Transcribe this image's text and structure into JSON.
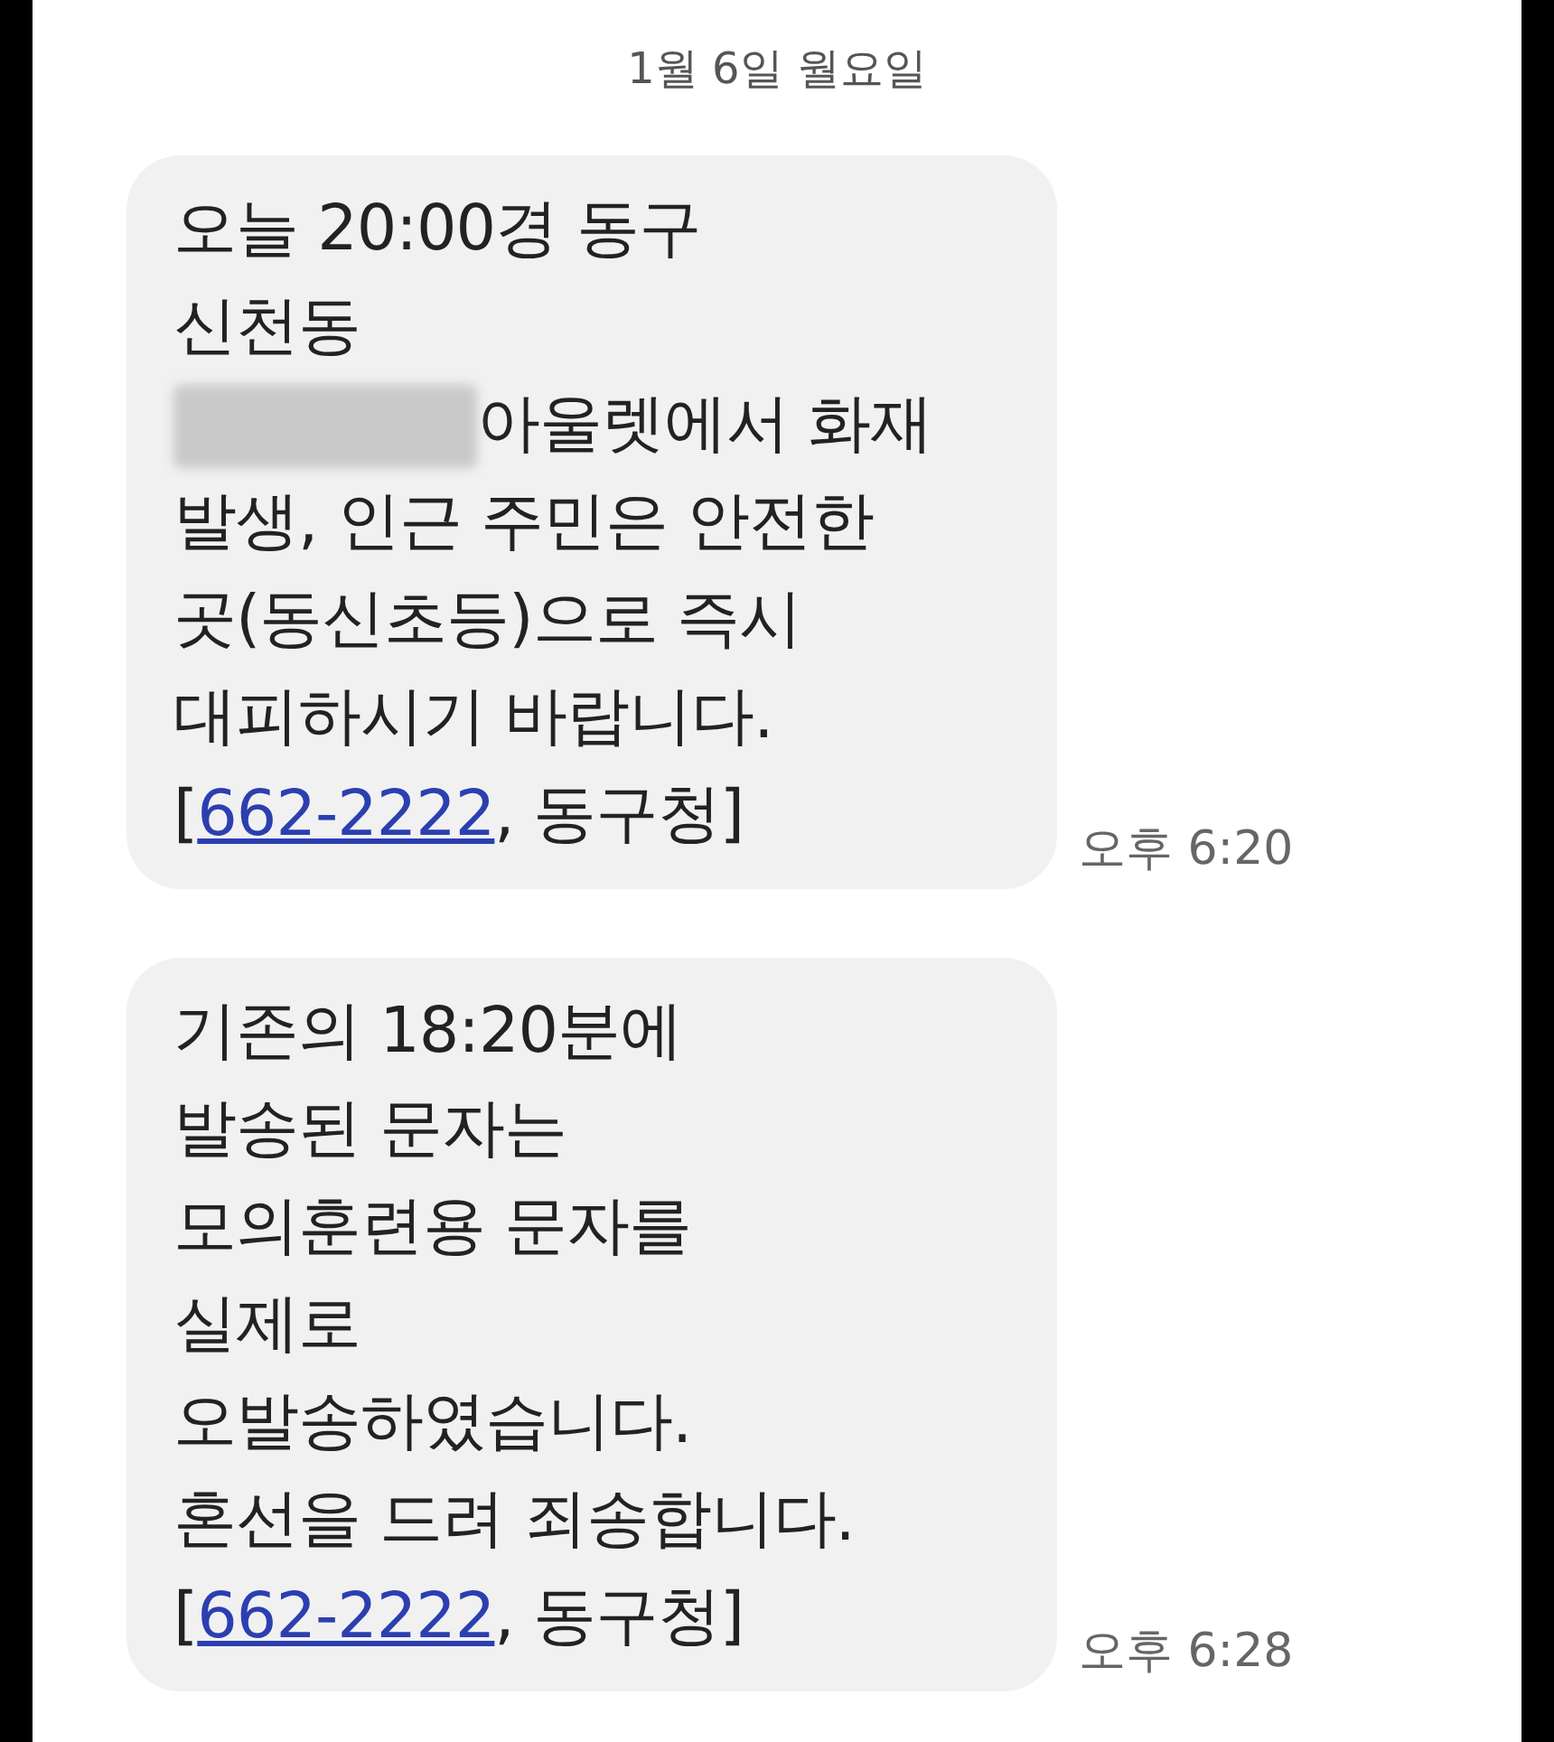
{
  "date_header": "1월 6일 월요일",
  "messages": [
    {
      "time": "오후 6:20",
      "lines": [
        [
          {
            "kind": "text",
            "text": "오늘 20:00경 동구"
          }
        ],
        [
          {
            "kind": "text",
            "text": "신천동"
          }
        ],
        [
          {
            "kind": "redacted"
          },
          {
            "kind": "text",
            "text": "아울렛에서 화재"
          }
        ],
        [
          {
            "kind": "text",
            "text": "발생, 인근 주민은 안전한"
          }
        ],
        [
          {
            "kind": "text",
            "text": "곳(동신초등)으로 즉시"
          }
        ],
        [
          {
            "kind": "text",
            "text": "대피하시기 바랍니다."
          }
        ],
        [
          {
            "kind": "text",
            "text": "["
          },
          {
            "kind": "link",
            "text": "662-2222"
          },
          {
            "kind": "text",
            "text": ", 동구청]"
          }
        ]
      ]
    },
    {
      "time": "오후 6:28",
      "lines": [
        [
          {
            "kind": "text",
            "text": "기존의 18:20분에"
          }
        ],
        [
          {
            "kind": "text",
            "text": "발송된 문자는"
          }
        ],
        [
          {
            "kind": "text",
            "text": "모의훈련용 문자를"
          }
        ],
        [
          {
            "kind": "text",
            "text": "실제로"
          }
        ],
        [
          {
            "kind": "text",
            "text": "오발송하였습니다."
          }
        ],
        [
          {
            "kind": "text",
            "text": "혼선을 드려 죄송합니다."
          }
        ],
        [
          {
            "kind": "text",
            "text": "["
          },
          {
            "kind": "link",
            "text": "662-2222"
          },
          {
            "kind": "text",
            "text": ", 동구청]"
          }
        ]
      ]
    }
  ]
}
